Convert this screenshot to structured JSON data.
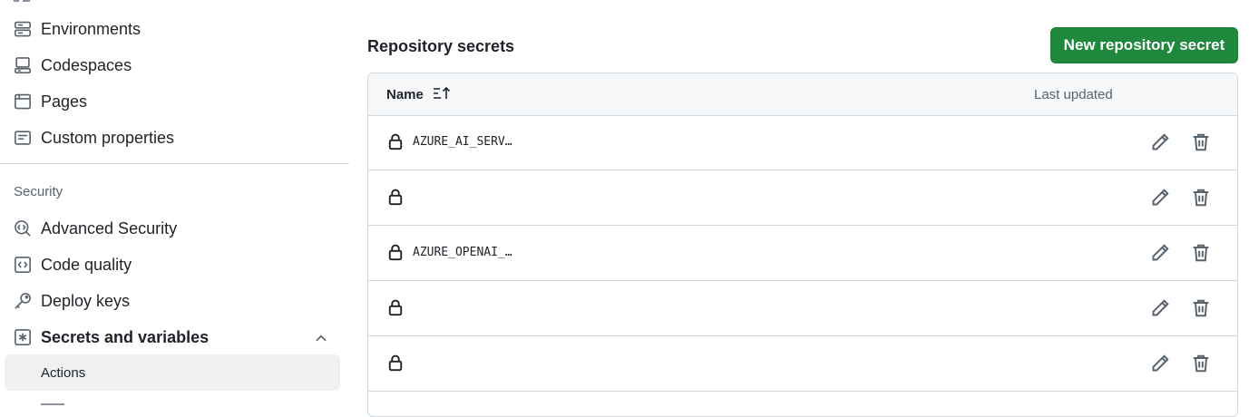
{
  "sidebar": {
    "items": [
      {
        "label": "Environments",
        "icon": "server-icon"
      },
      {
        "label": "Codespaces",
        "icon": "codespaces-icon"
      },
      {
        "label": "Pages",
        "icon": "browser-icon"
      },
      {
        "label": "Custom properties",
        "icon": "note-icon"
      }
    ],
    "security_heading": "Security",
    "security_items": [
      {
        "label": "Advanced Security",
        "icon": "codescan-icon"
      },
      {
        "label": "Code quality",
        "icon": "code-square-icon"
      },
      {
        "label": "Deploy keys",
        "icon": "key-icon"
      },
      {
        "label": "Secrets and variables",
        "icon": "asterisk-icon"
      }
    ],
    "active_sub_item": "Actions"
  },
  "main": {
    "title": "Repository secrets",
    "new_button": "New repository secret",
    "table": {
      "col_name": "Name",
      "col_updated": "Last updated",
      "rows": [
        {
          "name": "AZURE_AI_SERV…"
        },
        {
          "name": ""
        },
        {
          "name": "AZURE_OPENAI_…"
        },
        {
          "name": ""
        },
        {
          "name": ""
        }
      ]
    }
  },
  "colors": {
    "accent_green": "#1f883d",
    "border": "#d1d9e0",
    "muted_text": "#59636e",
    "active_bg": "#eef0f2"
  }
}
